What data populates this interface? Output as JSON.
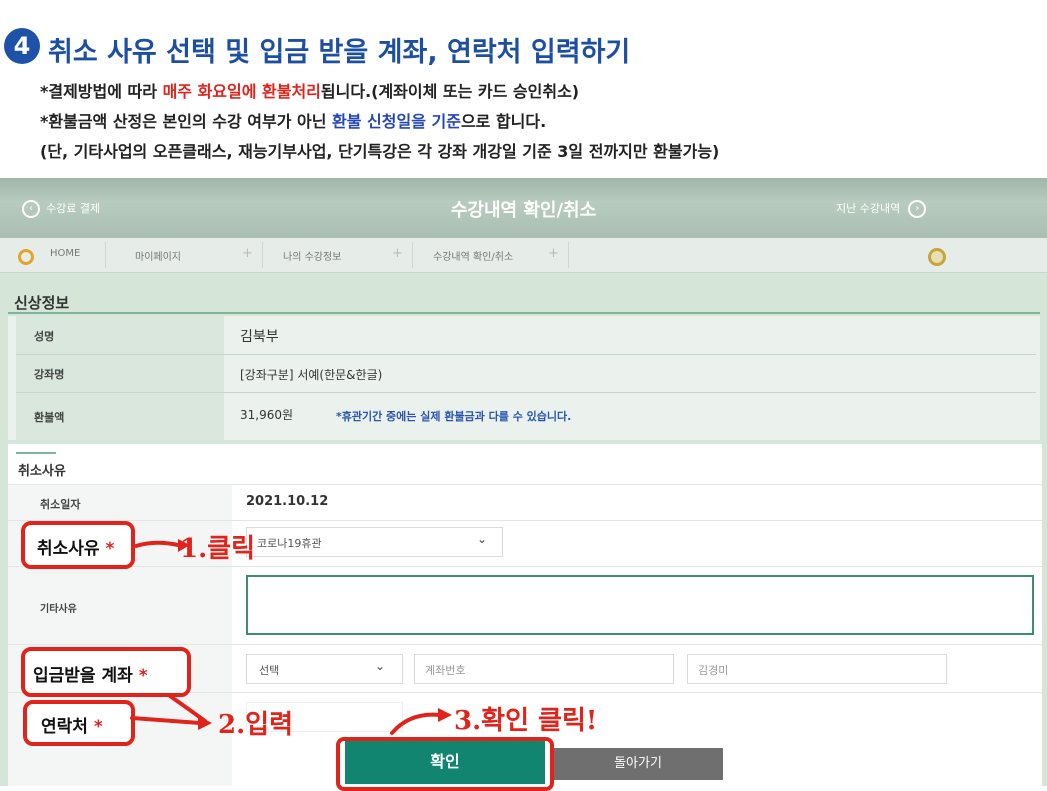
{
  "instruction": {
    "step_number": "4",
    "title": "취소 사유 선택 및 입금 받을 계좌, 연락처 입력하기",
    "note1": {
      "pre": "*결제방법에 따라 ",
      "highlight": "매주 화요일에 환불처리",
      "post": "됩니다.(계좌이체 또는 카드 승인취소)"
    },
    "note2": {
      "pre": "*환불금액 산정은 본인의 수강 여부가 아닌 ",
      "highlight": "환불 신청일을 기준",
      "post": "으로 합니다."
    },
    "note3": "(단, 기타사업의 오픈클래스, 재능기부사업, 단기특강은 각 강좌 개강일 기준 3일 전까지만 환불가능)"
  },
  "topbar": {
    "left_link": "수강료 결제",
    "title": "수강내역 확인/취소",
    "right_link": "지난 수강내역"
  },
  "breadcrumb": [
    "HOME",
    "마이페이지",
    "나의 수강정보",
    "수강내역 확인/취소"
  ],
  "personal_info": {
    "section_title": "신상정보",
    "rows": [
      {
        "label": "성명",
        "value": "김북부"
      },
      {
        "label": "강좌명",
        "value": "[강좌구분] 서예(한문&한글)"
      },
      {
        "label": "환불액",
        "value": "31,960원",
        "note": "*휴관기간 중에는 실제 환불금과 다를 수 있습니다."
      }
    ]
  },
  "cancel_form": {
    "section_title": "취소사유",
    "date_label": "취소일자",
    "date_value": "2021.10.12",
    "reason_label": "취소사유",
    "reason_value": "코로나19휴관",
    "other_label": "기타사유",
    "account_label": "입금받을 계좌",
    "bank_select": "선택",
    "account_placeholder": "계좌번호",
    "holder_placeholder": "김경미",
    "contact_label": "연락처",
    "required_mark": "*"
  },
  "buttons": {
    "confirm": "확인",
    "back": "돌아가기"
  },
  "annotations": {
    "a1": "1.클릭",
    "a2": "2.입력",
    "a3": "3.확인 클릭!"
  },
  "colors": {
    "accent_red": "#e0241b",
    "title_blue": "#1c4fa1",
    "button_green": "#128571"
  }
}
